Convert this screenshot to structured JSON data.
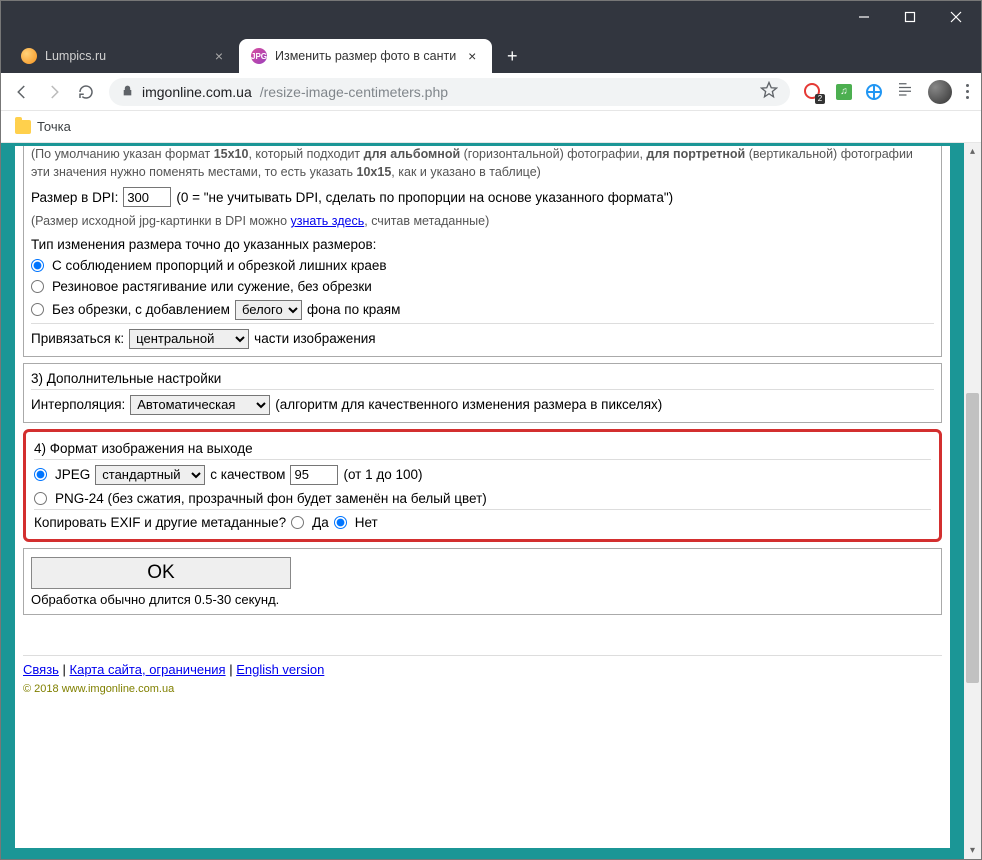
{
  "tabs": [
    {
      "title": "Lumpics.ru"
    },
    {
      "title": "Изменить размер фото в санти"
    }
  ],
  "url_domain": "imgonline.com.ua",
  "url_path": "/resize-image-centimeters.php",
  "ext_badge_count": "2",
  "bookmark_label": "Точка",
  "proportions_hint_prefix": "(По умолчанию указан формат ",
  "proportions_hint_b1": "15x10",
  "proportions_hint_mid1": ", который подходит ",
  "proportions_hint_b2": "для альбомной",
  "proportions_hint_mid2": " (горизонтальной) фотографии, ",
  "proportions_hint_b3": "для портретной",
  "proportions_hint_mid3": " (вертикальной) фотографии эти значения нужно поменять местами, то есть указать ",
  "proportions_hint_b4": "10x15",
  "proportions_hint_suffix": ", как и указано в таблице)",
  "dpi_label": "Размер в DPI:",
  "dpi_value": "300",
  "dpi_note": "(0 = \"не учитывать DPI, сделать по пропорции на основе указанного формата\")",
  "dpi_hint_prefix": "(Размер исходной jpg-картинки в DPI можно ",
  "dpi_hint_link": "узнать здесь",
  "dpi_hint_suffix": ", считав метаданные)",
  "resize_type_title": "Тип изменения размера точно до указанных размеров:",
  "resize_opt1": "С соблюдением пропорций и обрезкой лишних краев",
  "resize_opt2": "Резиновое растягивание или сужение, без обрезки",
  "resize_opt3_prefix": "Без обрезки, с добавлением",
  "resize_opt3_select": "белого",
  "resize_opt3_suffix": "фона по краям",
  "anchor_label": "Привязаться к:",
  "anchor_select": "центральной",
  "anchor_suffix": "части изображения",
  "section3_title": "3) Дополнительные настройки",
  "interp_label": "Интерполяция:",
  "interp_select": "Автоматическая",
  "interp_note": "(алгоритм для качественного изменения размера в пикселях)",
  "section4_title": "4) Формат изображения на выходе",
  "jpeg_label": "JPEG",
  "jpeg_select": "стандартный",
  "jpeg_quality_label": "с качеством",
  "jpeg_quality_value": "95",
  "jpeg_quality_note": "(от 1 до 100)",
  "png_label": "PNG-24 (без сжатия, прозрачный фон будет заменён на белый цвет)",
  "exif_label": "Копировать EXIF и другие метаданные?",
  "exif_yes": "Да",
  "exif_no": "Нет",
  "ok_label": "OK",
  "processing_note": "Обработка обычно длится 0.5-30 секунд.",
  "footer_contact": "Связь",
  "footer_sitemap": "Карта сайта, ограничения",
  "footer_english": "English version",
  "copyright": "© 2018 www.imgonline.com.ua"
}
